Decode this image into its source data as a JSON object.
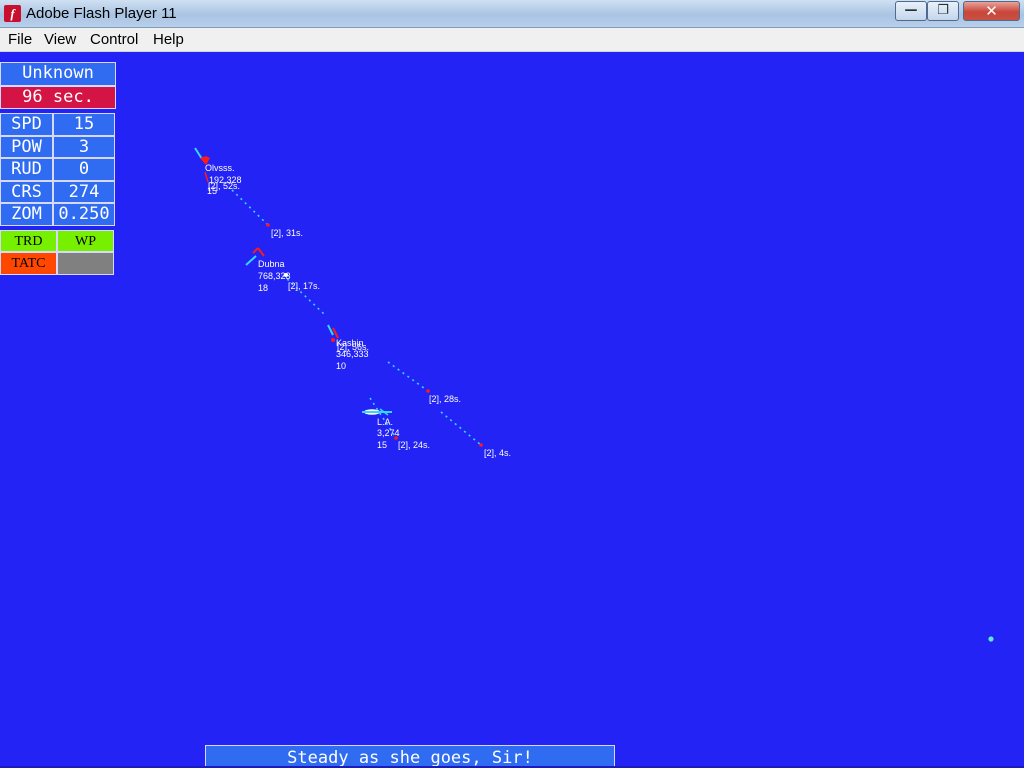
{
  "window": {
    "title": "Adobe Flash Player 11",
    "app_icon_glyph": "f",
    "minimize_icon": "minimize-icon",
    "maximize_icon": "maximize-icon",
    "close_icon": "close-icon"
  },
  "menu": {
    "items": [
      "File",
      "View",
      "Control",
      "Help"
    ]
  },
  "hud": {
    "target_name": "Unknown",
    "timer": "96 sec.",
    "rows": [
      {
        "label": "SPD",
        "value": "15"
      },
      {
        "label": "POW",
        "value": "3"
      },
      {
        "label": "RUD",
        "value": "0"
      },
      {
        "label": "CRS",
        "value": "274"
      },
      {
        "label": "ZOM",
        "value": "0.250"
      }
    ],
    "buttons": {
      "trd": "TRD",
      "wp": "WP",
      "tatc": "TATC",
      "blank": ""
    }
  },
  "contacts": [
    {
      "name": "Olvsss.",
      "range_bearing": "192,328",
      "speed": "15",
      "track_label": "[2], 52s."
    },
    {
      "name": "Dubna",
      "range_bearing": "768,323",
      "speed": "18",
      "track_label": "[2], 17s."
    },
    {
      "name": "Kashin",
      "range_bearing": "346,333",
      "speed": "10",
      "track_label": "[2], 56s."
    },
    {
      "name": "L.A.",
      "range_bearing": "3,274",
      "speed": "15",
      "track_label": "[2], 24s."
    }
  ],
  "track_markers": [
    "[2], 31s.",
    "[2], 28s.",
    "[2], 4s."
  ],
  "colors": {
    "sea": "#2323f5",
    "hud_blue": "#2f6cf2",
    "hud_red": "#d41444",
    "hud_green": "#77f000",
    "hud_orange": "#ff4700",
    "track_cyan": "#33d6ff",
    "hostile_red": "#ff1a1a"
  },
  "status_message": "Steady as she goes, Sir!"
}
